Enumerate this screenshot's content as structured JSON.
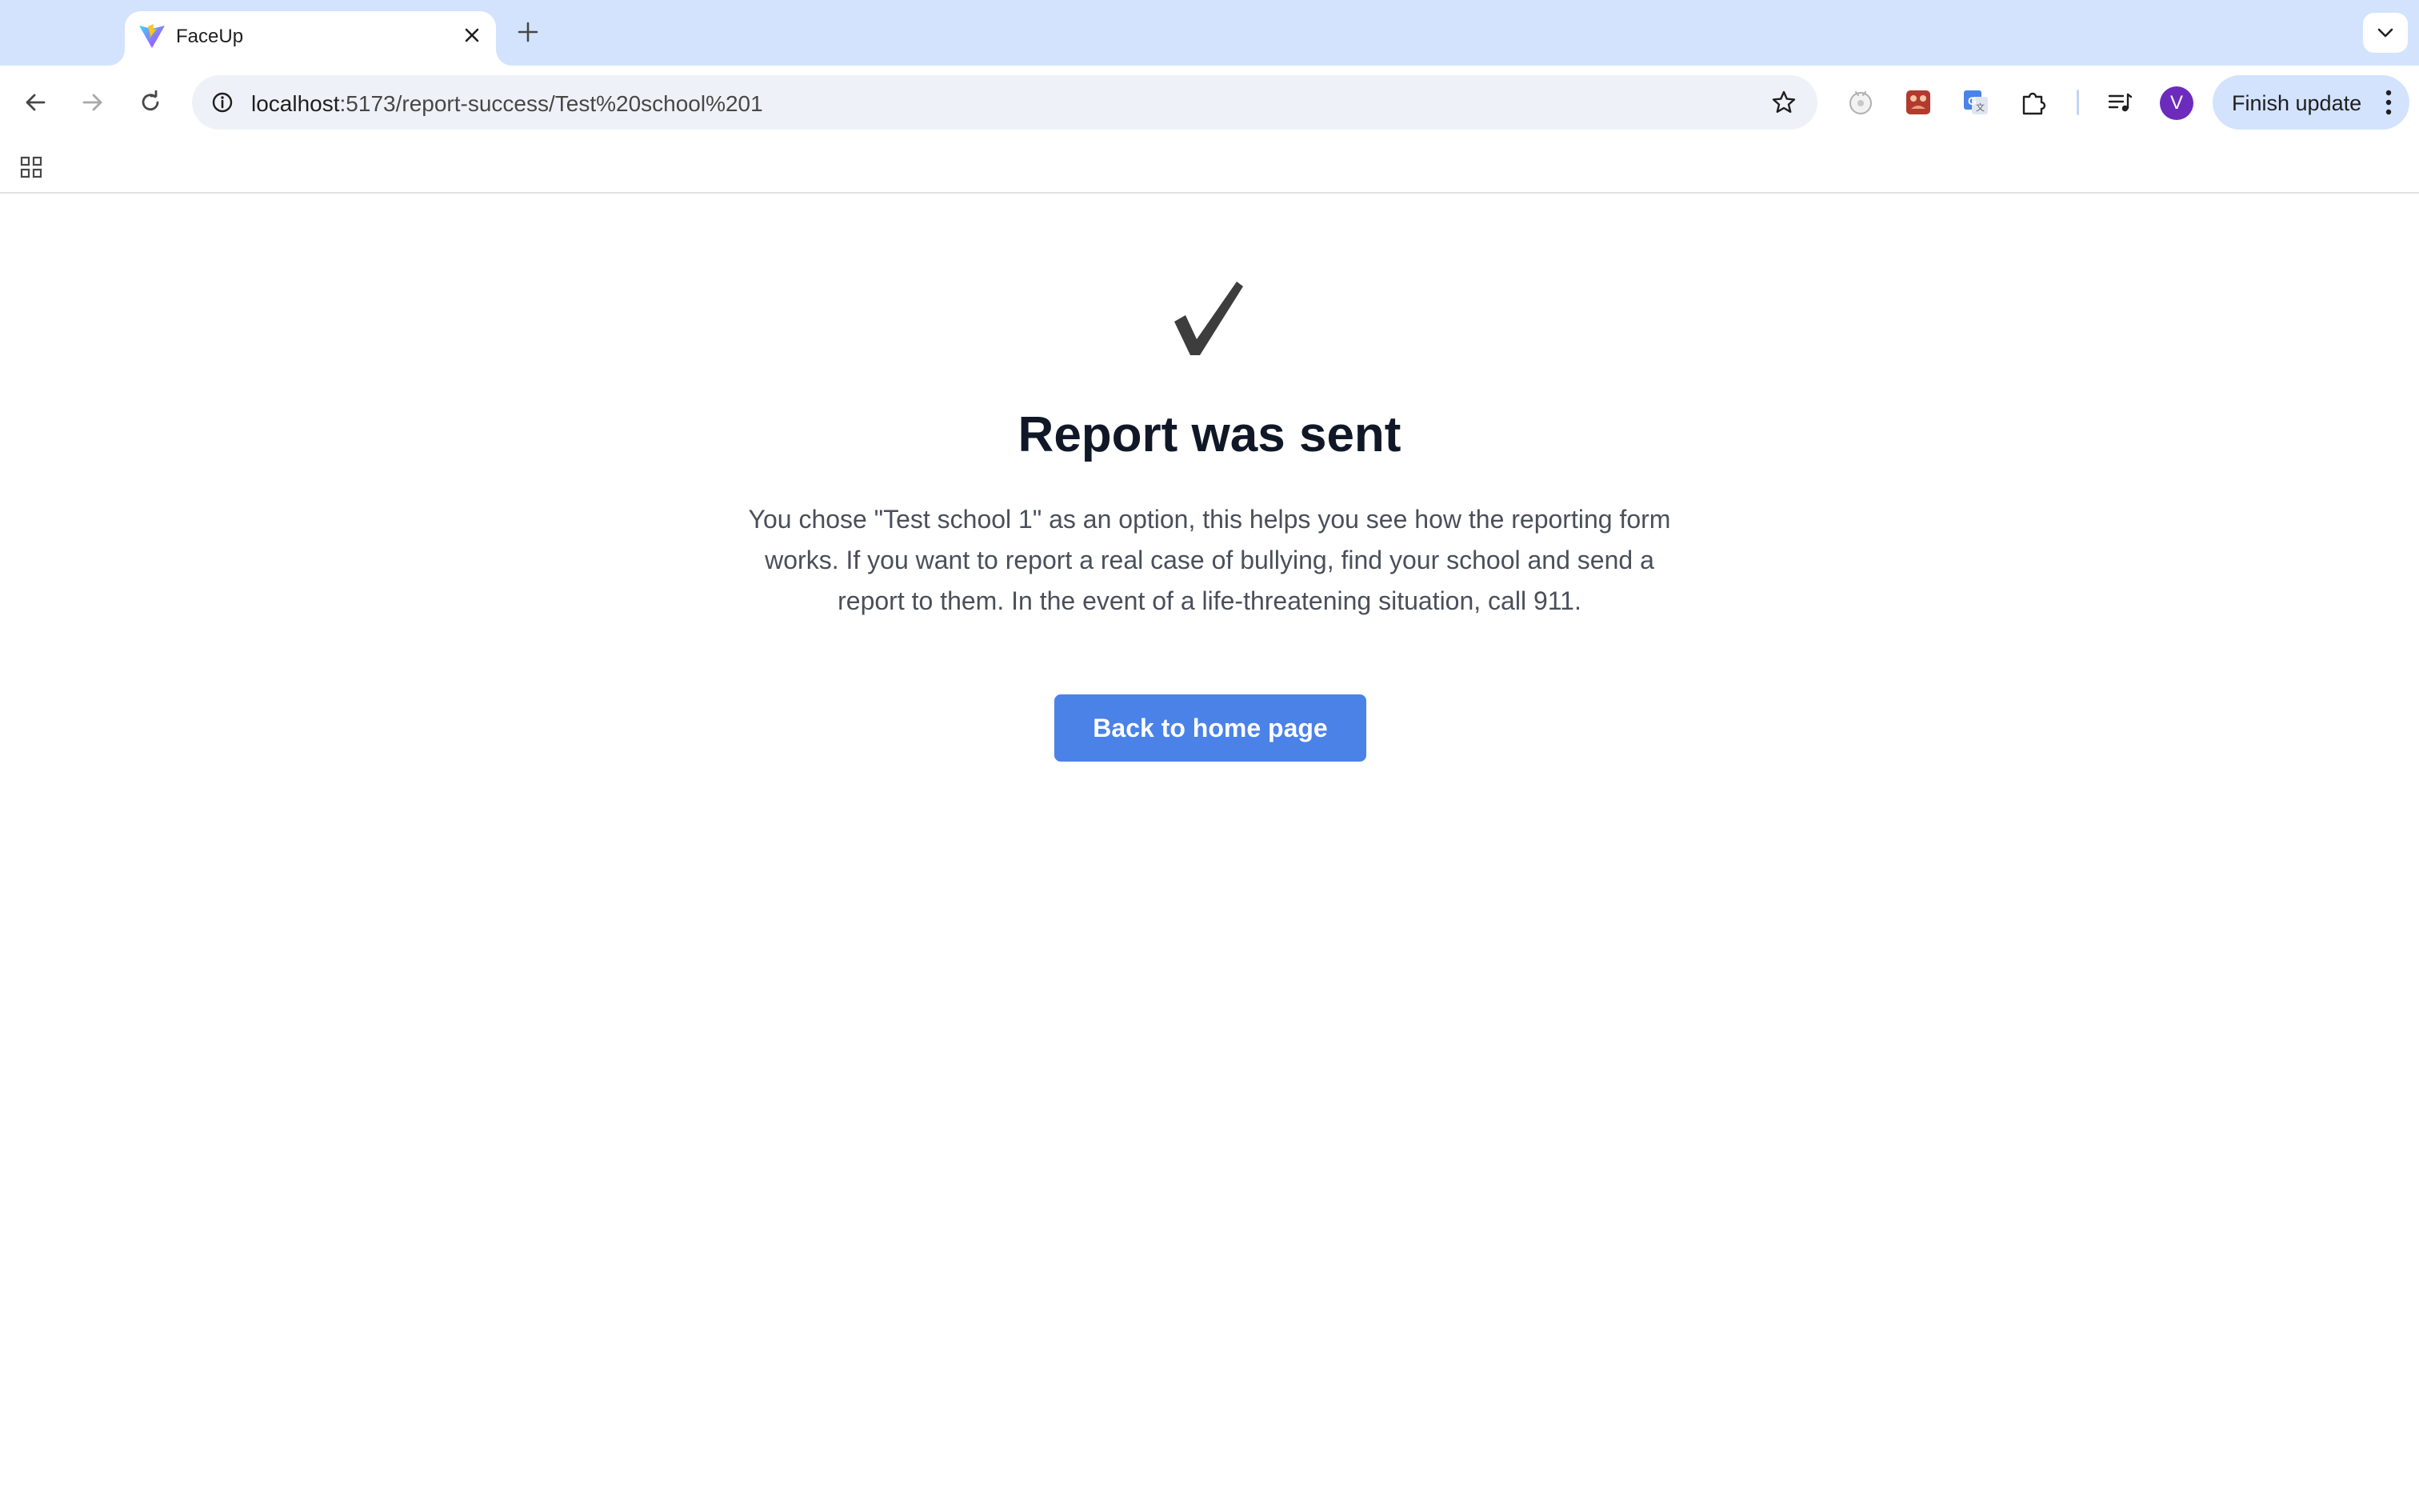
{
  "browser": {
    "tab": {
      "title": "FaceUp",
      "favicon": "vite-logo-icon"
    },
    "url": {
      "host": "localhost",
      "path": ":5173/report-success/Test%20school%201"
    },
    "update_button": "Finish update",
    "profile_initial": "V",
    "colors": {
      "tabstrip": "#d3e3fd",
      "omnibox": "#eef2f8",
      "avatar": "#6c2bbd"
    }
  },
  "page": {
    "title": "Report was sent",
    "message": "You chose \"Test school 1\" as an option, this helps you see how the reporting form works. If you want to report a real case of bullying, find your school and send a report to them. In the event of a life-threatening situation, call 911.",
    "button_label": "Back to home page",
    "colors": {
      "button": "#4a82e8",
      "title": "#101828",
      "check": "#3d3d3d"
    }
  }
}
